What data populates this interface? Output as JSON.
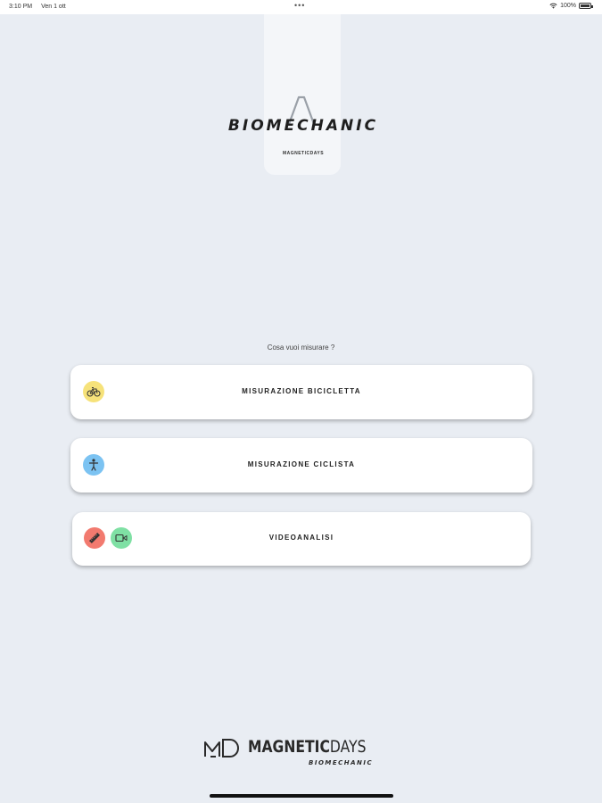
{
  "status_bar": {
    "time": "3:10 PM",
    "date": "Ven 1 ott",
    "dots": "•••",
    "battery": "100%"
  },
  "header": {
    "logo_title": "BIOMECHANIC",
    "logo_subtitle": "MAGNETICDAYS"
  },
  "main": {
    "prompt": "Cosa vuoi misurare ?",
    "options": [
      {
        "label": "MISURAZIONE BICICLETTA",
        "icons": [
          "bicycle-icon"
        ],
        "colors": [
          "#f6e27a"
        ]
      },
      {
        "label": "MISURAZIONE CICLISTA",
        "icons": [
          "person-icon"
        ],
        "colors": [
          "#7cc3f2"
        ]
      },
      {
        "label": "VIDEOANALISI",
        "icons": [
          "ruler-icon",
          "video-camera-icon"
        ],
        "colors": [
          "#f27a6f",
          "#7fe0a4"
        ]
      }
    ]
  },
  "footer": {
    "brand_main": "MAGNETIC",
    "brand_days": "DAYS",
    "brand_sub": "BIOMECHANIC"
  }
}
